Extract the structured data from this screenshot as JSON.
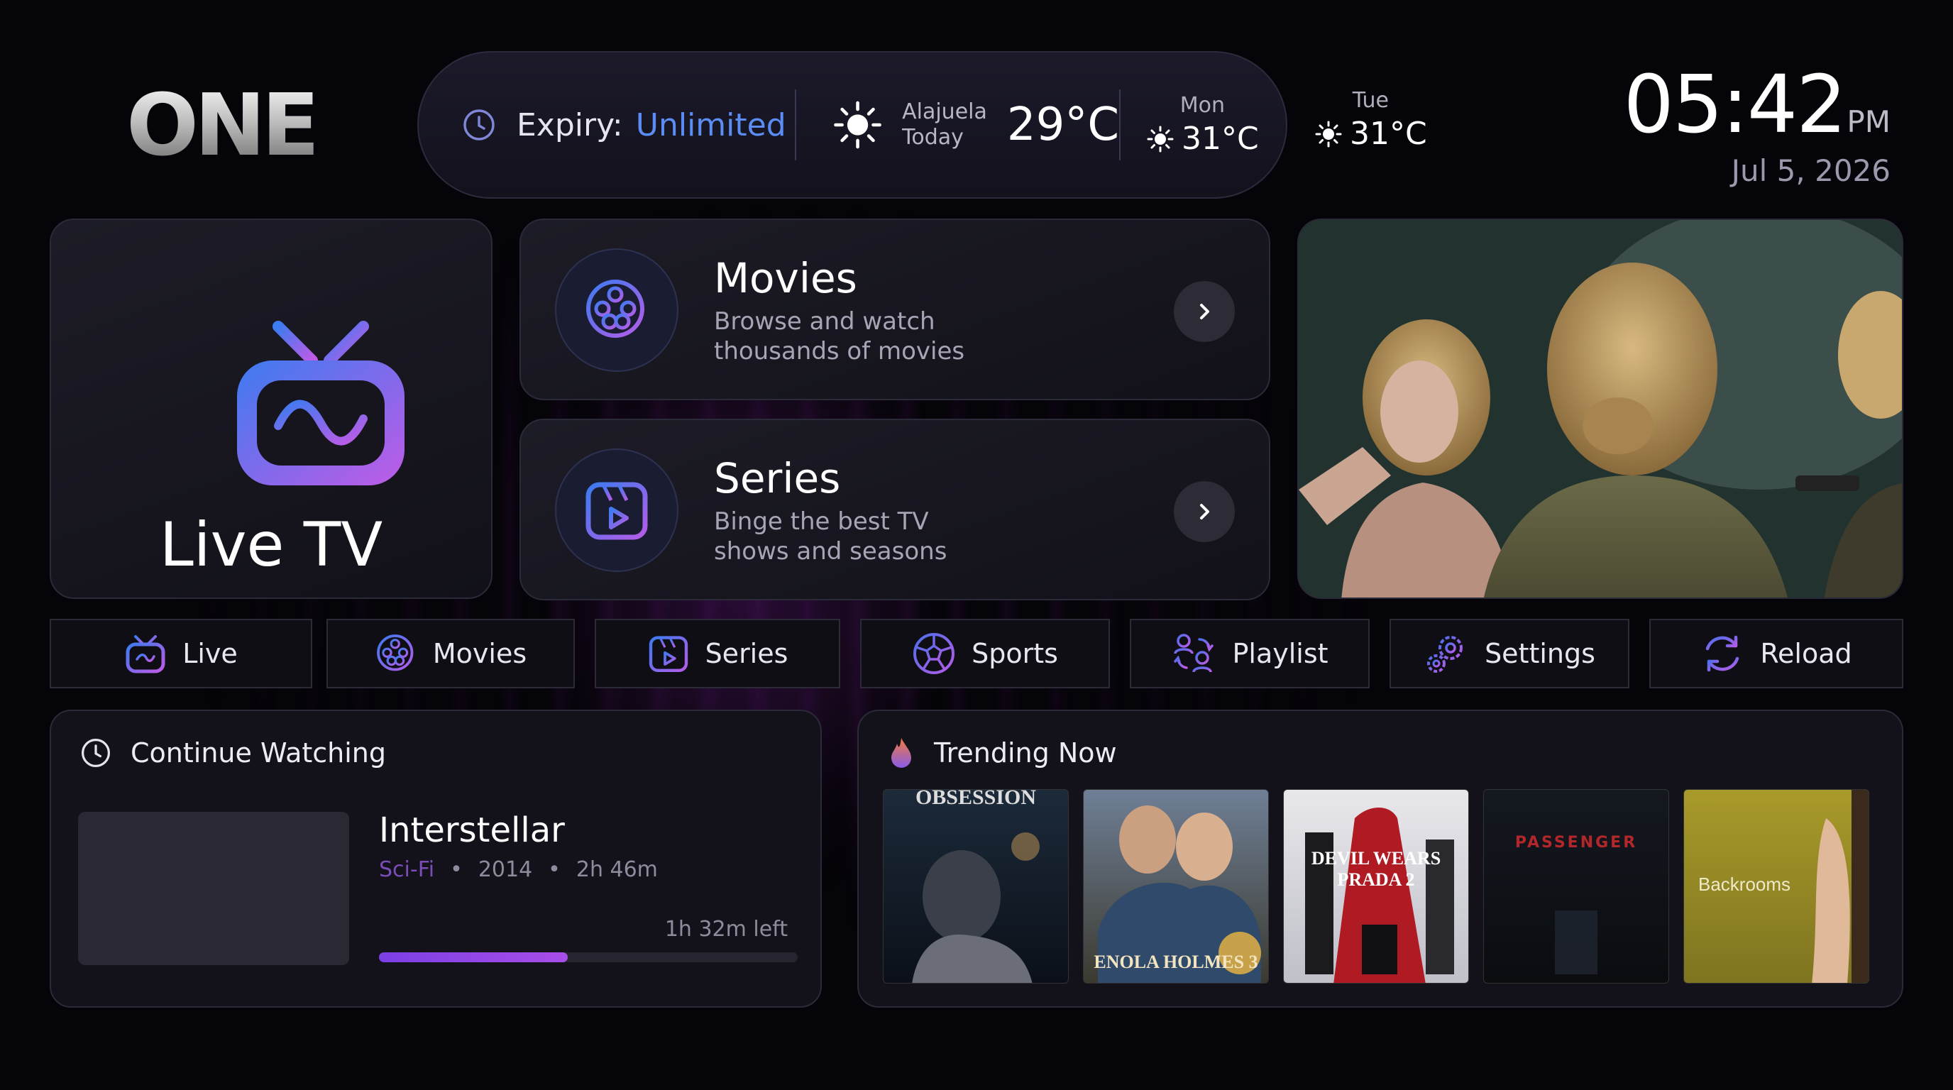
{
  "brand": {
    "logo_text": "ONE"
  },
  "status": {
    "expiry_label": "Expiry:",
    "expiry_value": "Unlimited",
    "city": "Alajuela",
    "day_label": "Today",
    "current_temp": "29°C",
    "forecast": [
      {
        "day": "Mon",
        "temp": "31°C"
      },
      {
        "day": "Tue",
        "temp": "31°C"
      }
    ]
  },
  "clock": {
    "time": "05:42",
    "ampm": "PM",
    "date": "Jul 5, 2026"
  },
  "cards": {
    "live_tv": {
      "label": "Live TV"
    },
    "movies": {
      "title": "Movies",
      "description": "Browse and watch thousands of movies"
    },
    "series": {
      "title": "Series",
      "description": "Binge the best TV shows and seasons"
    }
  },
  "nav": [
    {
      "label": "Live",
      "icon": "tv-icon"
    },
    {
      "label": "Movies",
      "icon": "film-reel-icon"
    },
    {
      "label": "Series",
      "icon": "clapper-icon"
    },
    {
      "label": "Sports",
      "icon": "soccer-ball-icon"
    },
    {
      "label": "Playlist",
      "icon": "playlist-users-icon"
    },
    {
      "label": "Settings",
      "icon": "gear-icon"
    },
    {
      "label": "Reload",
      "icon": "reload-icon"
    }
  ],
  "continue_watching": {
    "heading": "Continue Watching",
    "title": "Interstellar",
    "genre": "Sci-Fi",
    "year": "2014",
    "duration": "2h 46m",
    "time_left": "1h 32m left",
    "progress": 0.45
  },
  "trending": {
    "heading": "Trending Now",
    "posters": [
      {
        "title": "OBSESSION"
      },
      {
        "title": "ENOLA HOLMES 3"
      },
      {
        "title": "DEVIL WEARS PRADA 2"
      },
      {
        "title": "PASSENGER"
      },
      {
        "title": "Backrooms"
      }
    ]
  },
  "colors": {
    "accent_blue": "#5B8DF5",
    "accent_purple": "#A84EE8",
    "background": "#050408"
  }
}
